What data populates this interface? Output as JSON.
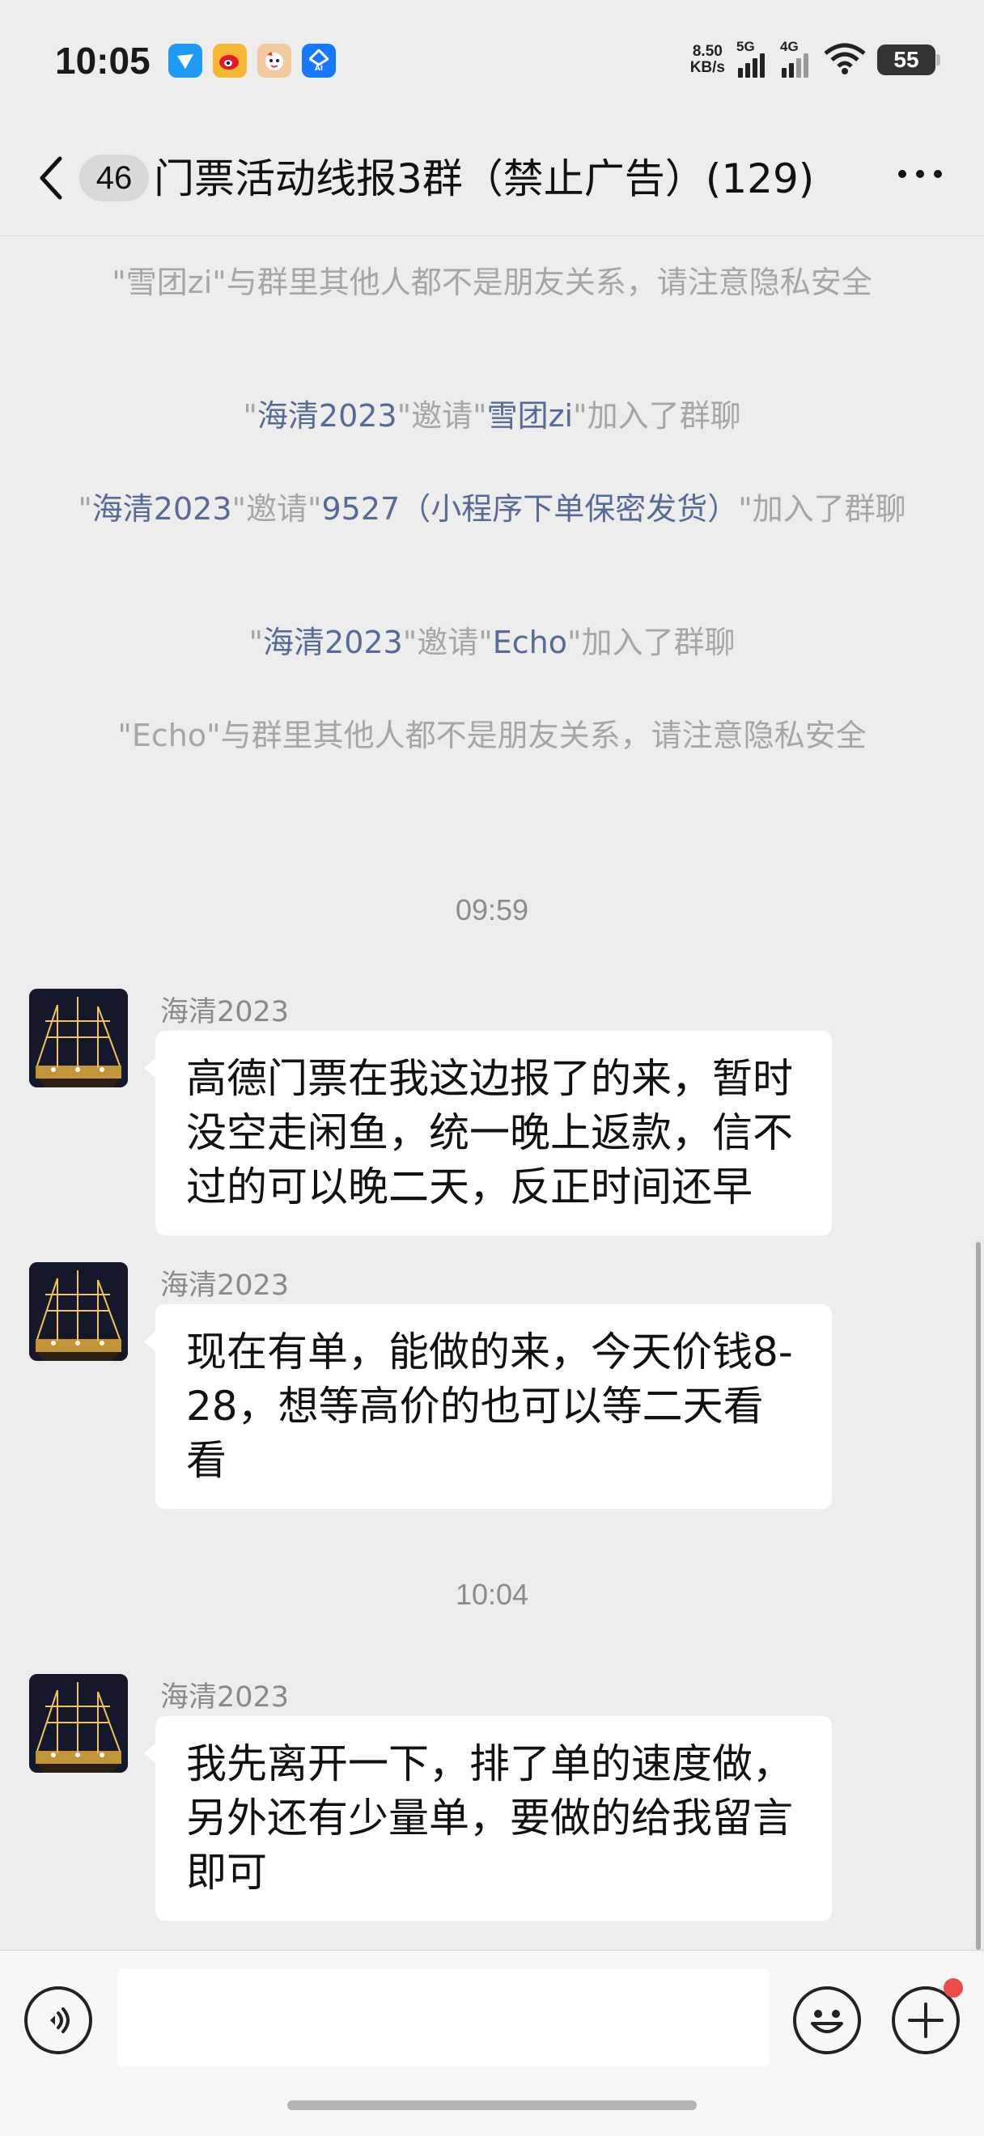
{
  "status_bar": {
    "time": "10:05",
    "net_speed_value": "8.50",
    "net_speed_unit": "KB/s",
    "signal1_label": "5G",
    "signal2_label": "4G",
    "battery": "55",
    "app_icons": [
      "app-icon-blue",
      "weibo-icon",
      "app-icon-character",
      "ai-app-icon"
    ],
    "ai_icon_label": "AI"
  },
  "header": {
    "unread_count": "46",
    "title": "门票活动线报3群（禁止广告）(129)"
  },
  "system_messages": [
    {
      "parts": [
        {
          "t": "\"雪团zi\"与群里其他人都不是朋友关系，请注意隐私安全",
          "link": false
        }
      ]
    },
    {
      "parts": [
        {
          "t": "\"",
          "link": false
        },
        {
          "t": "海清2023",
          "link": true
        },
        {
          "t": "\"邀请\"",
          "link": false
        },
        {
          "t": "雪团zi",
          "link": true
        },
        {
          "t": "\"加入了群聊",
          "link": false
        }
      ]
    },
    {
      "parts": [
        {
          "t": "\"",
          "link": false
        },
        {
          "t": "海清2023",
          "link": true
        },
        {
          "t": "\"邀请\"",
          "link": false
        },
        {
          "t": "9527（小程序下单保密发货）",
          "link": true
        },
        {
          "t": "\"加入了群聊",
          "link": false
        }
      ]
    },
    {
      "parts": [
        {
          "t": "\"",
          "link": false
        },
        {
          "t": "海清2023",
          "link": true
        },
        {
          "t": "\"邀请\"",
          "link": false
        },
        {
          "t": "Echo",
          "link": true
        },
        {
          "t": "\"加入了群聊",
          "link": false
        }
      ]
    },
    {
      "parts": [
        {
          "t": "\"Echo\"与群里其他人都不是朋友关系，请注意隐私安全",
          "link": false
        }
      ]
    }
  ],
  "timestamps": [
    "09:59",
    "10:04"
  ],
  "messages": [
    {
      "sender": "海清2023",
      "text": "高德门票在我这边报了的来，暂时没空走闲鱼，统一晚上返款，信不过的可以晚二天，反正时间还早"
    },
    {
      "sender": "海清2023",
      "text": "现在有单，能做的来，今天价钱8-28，想等高价的也可以等二天看看"
    },
    {
      "sender": "海清2023",
      "text": "我先离开一下，排了单的速度做，另外还有少量单，要做的给我留言即可"
    }
  ],
  "input": {
    "value": "",
    "placeholder": ""
  },
  "colors": {
    "link": "#576b95",
    "background": "#ededed",
    "bubble": "#ffffff",
    "badge_dot": "#f04b4b"
  }
}
